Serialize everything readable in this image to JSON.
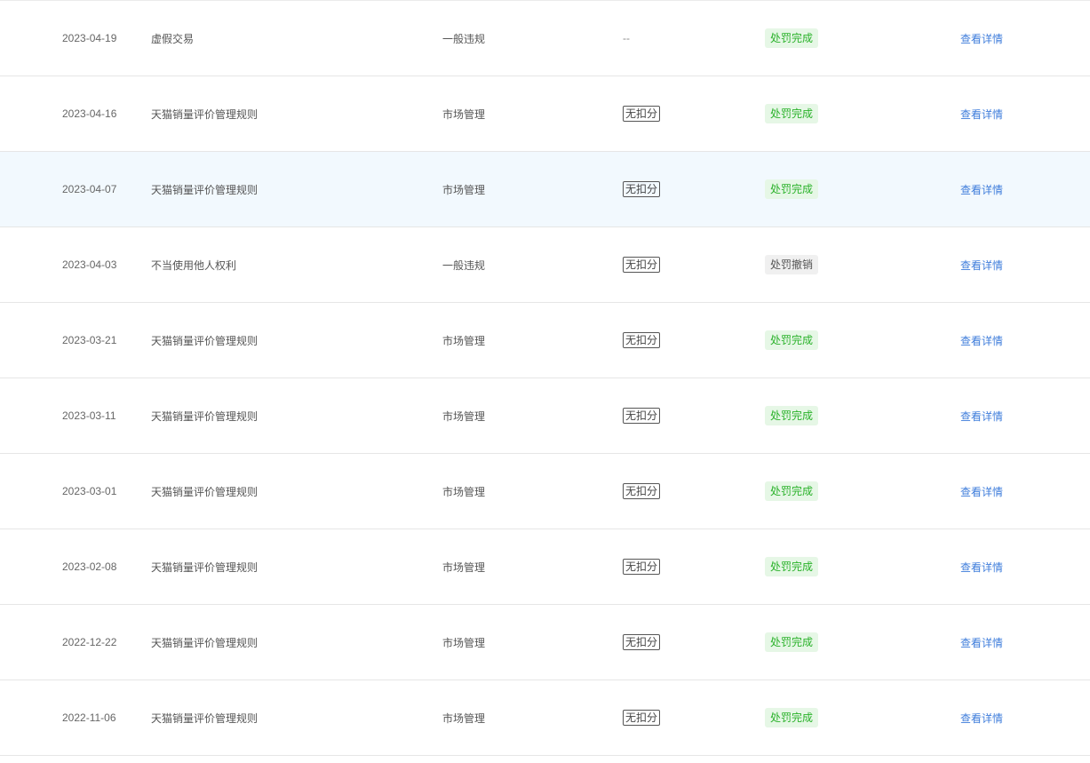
{
  "rows": [
    {
      "date": "2023-04-19",
      "reason": "虚假交易",
      "type": "一般违规",
      "points": "--",
      "points_style": "plain",
      "status": "处罚完成",
      "status_kind": "done",
      "action": "查看详情"
    },
    {
      "date": "2023-04-16",
      "reason": "天猫销量评价管理规则",
      "type": "市场管理",
      "points": "无扣分",
      "points_style": "tag",
      "status": "处罚完成",
      "status_kind": "done",
      "action": "查看详情"
    },
    {
      "date": "2023-04-07",
      "reason": "天猫销量评价管理规则",
      "type": "市场管理",
      "points": "无扣分",
      "points_style": "tag",
      "status": "处罚完成",
      "status_kind": "done",
      "action": "查看详情",
      "highlight": true
    },
    {
      "date": "2023-04-03",
      "reason": "不当使用他人权利",
      "type": "一般违规",
      "points": "无扣分",
      "points_style": "tag",
      "status": "处罚撤销",
      "status_kind": "cancel",
      "action": "查看详情"
    },
    {
      "date": "2023-03-21",
      "reason": "天猫销量评价管理规则",
      "type": "市场管理",
      "points": "无扣分",
      "points_style": "tag",
      "status": "处罚完成",
      "status_kind": "done",
      "action": "查看详情"
    },
    {
      "date": "2023-03-11",
      "reason": "天猫销量评价管理规则",
      "type": "市场管理",
      "points": "无扣分",
      "points_style": "tag",
      "status": "处罚完成",
      "status_kind": "done",
      "action": "查看详情"
    },
    {
      "date": "2023-03-01",
      "reason": "天猫销量评价管理规则",
      "type": "市场管理",
      "points": "无扣分",
      "points_style": "tag",
      "status": "处罚完成",
      "status_kind": "done",
      "action": "查看详情"
    },
    {
      "date": "2023-02-08",
      "reason": "天猫销量评价管理规则",
      "type": "市场管理",
      "points": "无扣分",
      "points_style": "tag",
      "status": "处罚完成",
      "status_kind": "done",
      "action": "查看详情"
    },
    {
      "date": "2022-12-22",
      "reason": "天猫销量评价管理规则",
      "type": "市场管理",
      "points": "无扣分",
      "points_style": "tag",
      "status": "处罚完成",
      "status_kind": "done",
      "action": "查看详情"
    },
    {
      "date": "2022-11-06",
      "reason": "天猫销量评价管理规则",
      "type": "市场管理",
      "points": "无扣分",
      "points_style": "tag",
      "status": "处罚完成",
      "status_kind": "done",
      "action": "查看详情"
    }
  ],
  "colors": {
    "link": "#3f7ddb",
    "status_done_bg": "#e6f7e6",
    "status_done_text": "#2ab22a",
    "status_cancel_bg": "#f0f0f0",
    "highlight_row_bg": "#f2f9fe"
  }
}
